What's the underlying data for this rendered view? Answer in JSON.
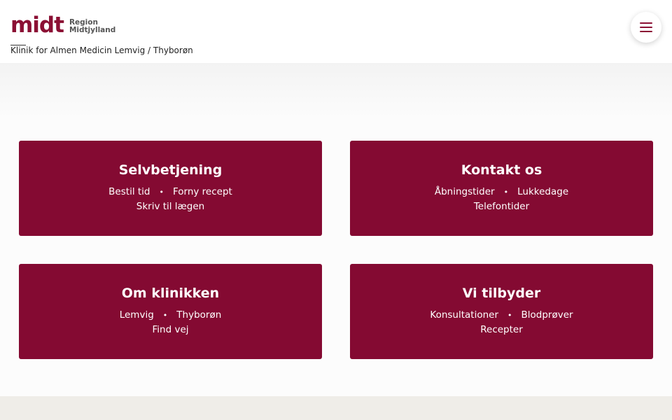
{
  "header": {
    "logo_mark": "midt",
    "logo_line1": "Region",
    "logo_line2": "Midtjylland",
    "clinic_name": "Klinik for Almen Medicin Lemvig / Thyborøn",
    "menu_icon": "hamburger-menu-icon"
  },
  "cards": [
    {
      "title": "Selvbetjening",
      "row1": [
        "Bestil tid",
        "Forny recept"
      ],
      "row2": "Skriv til lægen"
    },
    {
      "title": "Kontakt os",
      "row1": [
        "Åbningstider",
        "Lukkedage"
      ],
      "row2": "Telefontider"
    },
    {
      "title": "Om klinikken",
      "row1": [
        "Lemvig",
        "Thyborøn"
      ],
      "row2": "Find vej"
    },
    {
      "title": "Vi tilbyder",
      "row1": [
        "Konsultationer",
        "Blodprøver"
      ],
      "row2": "Recepter"
    }
  ],
  "separator": "•",
  "colors": {
    "brand": "#840a32",
    "footer": "#efede8",
    "text": "#222222"
  }
}
